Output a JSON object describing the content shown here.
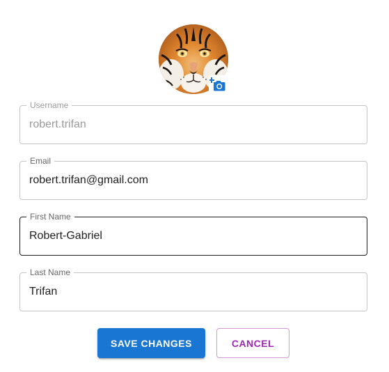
{
  "profile": {
    "avatar_alt": "Tiger profile picture",
    "avatar_icon": "tiger-photo",
    "change_photo_icon": "add-a-photo-icon"
  },
  "form": {
    "username": {
      "label": "Username",
      "value": "robert.trifan",
      "disabled": true
    },
    "email": {
      "label": "Email",
      "value": "robert.trifan@gmail.com"
    },
    "first_name": {
      "label": "First Name",
      "value": "Robert-Gabriel",
      "focused": true
    },
    "last_name": {
      "label": "Last Name",
      "value": "Trifan"
    }
  },
  "actions": {
    "save_label": "SAVE CHANGES",
    "cancel_label": "CANCEL"
  },
  "colors": {
    "primary": "#1976d2",
    "secondary": "#9c27b0",
    "border": "#c4c4c4",
    "focused_border": "#1a1a1a"
  }
}
